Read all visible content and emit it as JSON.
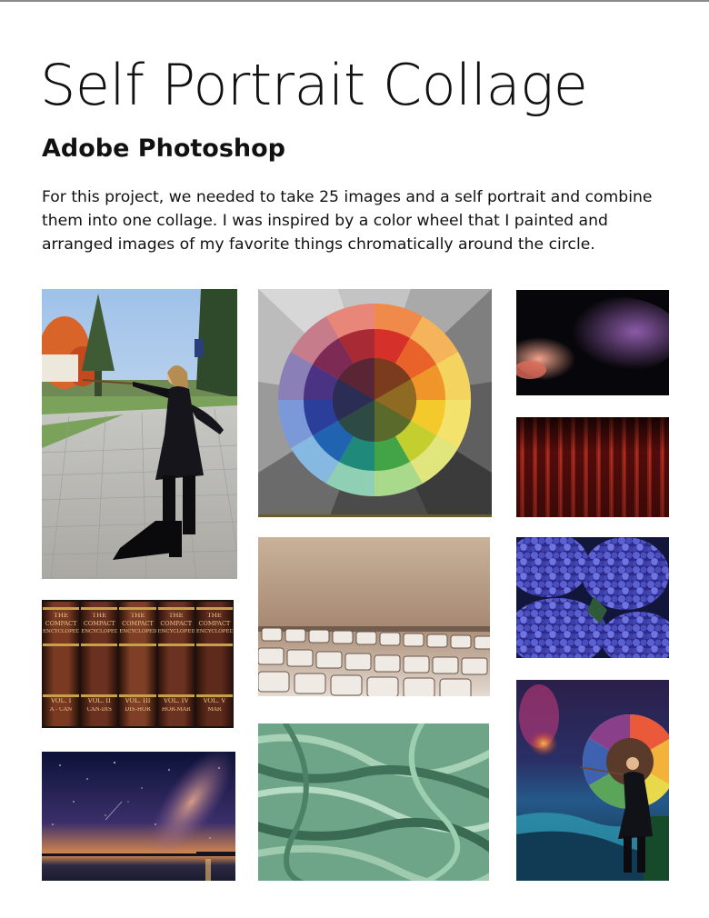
{
  "page": {
    "title": "Self Portrait Collage",
    "subtitle": "Adobe Photoshop",
    "description": "For this project, we needed to take 25 images and a self portrait and combine them into one collage. I was inspired by a color wheel that I painted and arranged images of my favorite things chromatically around the circle."
  },
  "photos": {
    "books": {
      "spines": [
        {
          "line1": "THE",
          "line2": "COMPACT",
          "line3": "ENCYCLOPEDIA",
          "vol": "VOL. I",
          "range": "A - CAN"
        },
        {
          "line1": "THE",
          "line2": "COMPACT",
          "line3": "ENCYCLOPEDIA",
          "vol": "VOL. II",
          "range": "CAN-DIS"
        },
        {
          "line1": "THE",
          "line2": "COMPACT",
          "line3": "ENCYCLOPEDIA",
          "vol": "VOL. III",
          "range": "DIS-HOR"
        },
        {
          "line1": "THE",
          "line2": "COMPACT",
          "line3": "ENCYCLOPEDIA",
          "vol": "VOL. IV",
          "range": "HOR-MAR"
        },
        {
          "line1": "THE",
          "line2": "COMPACT",
          "line3": "ENCYCLOPEDIA",
          "vol": "VOL. V",
          "range": "MAR"
        }
      ]
    }
  }
}
